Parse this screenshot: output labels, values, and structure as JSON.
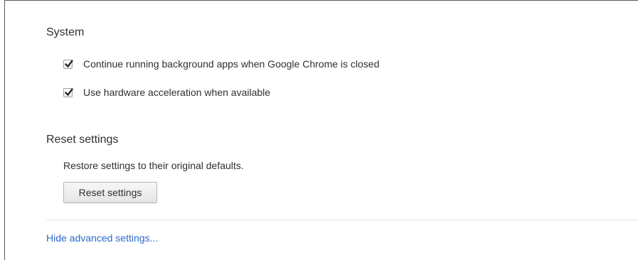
{
  "system": {
    "title": "System",
    "options": [
      {
        "label": "Continue running background apps when Google Chrome is closed",
        "checked": true
      },
      {
        "label": "Use hardware acceleration when available",
        "checked": true
      }
    ]
  },
  "reset": {
    "title": "Reset settings",
    "description": "Restore settings to their original defaults.",
    "button_label": "Reset settings"
  },
  "footer": {
    "link_label": "Hide advanced settings..."
  },
  "colors": {
    "link": "#2a6ac8",
    "text": "#303030",
    "divider": "#e6e6e6"
  }
}
